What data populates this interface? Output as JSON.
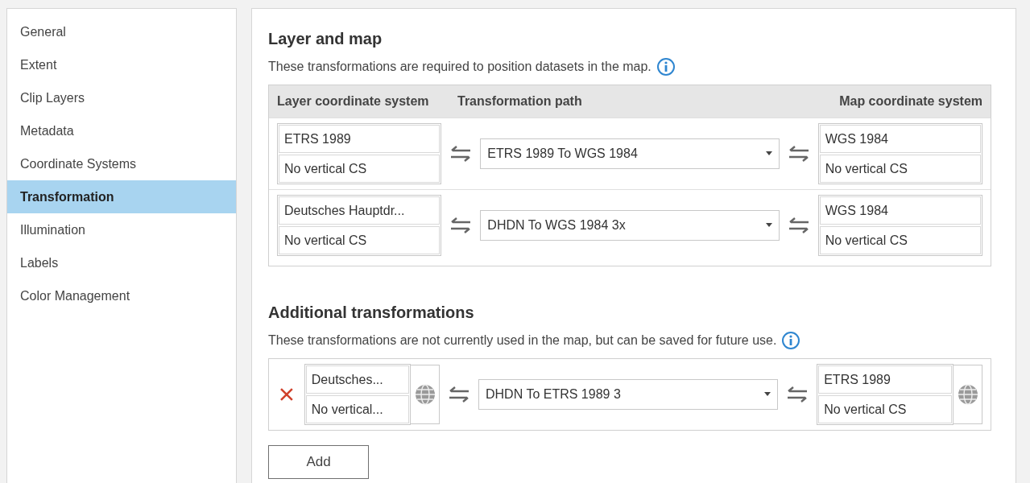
{
  "sidebar": {
    "items": [
      {
        "label": "General",
        "selected": false
      },
      {
        "label": "Extent",
        "selected": false
      },
      {
        "label": "Clip Layers",
        "selected": false
      },
      {
        "label": "Metadata",
        "selected": false
      },
      {
        "label": "Coordinate Systems",
        "selected": false
      },
      {
        "label": "Transformation",
        "selected": true
      },
      {
        "label": "Illumination",
        "selected": false
      },
      {
        "label": "Labels",
        "selected": false
      },
      {
        "label": "Color Management",
        "selected": false
      }
    ]
  },
  "layer_and_map": {
    "title": "Layer and map",
    "description": "These transformations are required to position datasets in the map.",
    "columns": [
      "Layer coordinate system",
      "Transformation path",
      "Map coordinate system"
    ],
    "rows": [
      {
        "layer_cs": "ETRS 1989",
        "layer_vcs": "No vertical CS",
        "path": "ETRS 1989 To WGS 1984",
        "map_cs": "WGS 1984",
        "map_vcs": "No vertical CS"
      },
      {
        "layer_cs": "Deutsches Hauptdr...",
        "layer_vcs": "No vertical CS",
        "path": "DHDN To WGS 1984 3x",
        "map_cs": "WGS 1984",
        "map_vcs": "No vertical CS"
      }
    ]
  },
  "additional": {
    "title": "Additional transformations",
    "description": "These transformations are not currently used in the map, but can be saved for future use.",
    "rows": [
      {
        "layer_cs": "Deutsches...",
        "layer_vcs": "No vertical...",
        "path": "DHDN To ETRS 1989 3",
        "map_cs": "ETRS 1989",
        "map_vcs": "No vertical CS"
      }
    ],
    "add_button": "Add"
  }
}
